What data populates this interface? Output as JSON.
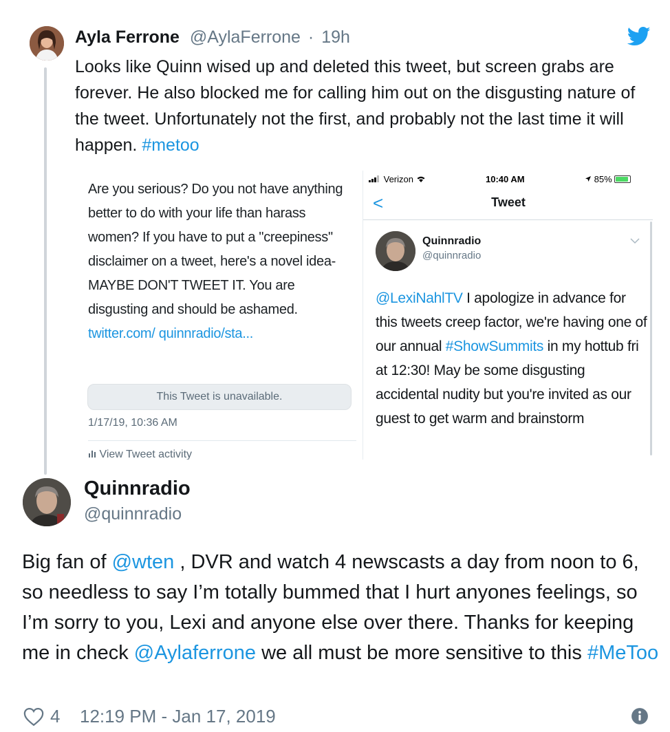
{
  "tweet1": {
    "name": "Ayla Ferrone",
    "handle": "@AylaFerrone",
    "separator": "·",
    "time": "19h",
    "text_before": "Looks like Quinn wised up and deleted this tweet, but screen grabs are forever. He also blocked me for calling him out on the disgusting nature of the tweet. Unfortunately not the first, and probably not the last time it will happen. ",
    "hashtag": "#metoo",
    "icons": {
      "avatar": "avatar",
      "brand": "twitter-bird-icon"
    }
  },
  "screengrab_left": {
    "text": "Are you serious? Do you not have anything better to do with your life than harass women? If you have to put a \"creepiness\" disclaimer on a tweet, here's a novel idea-MAYBE DON'T TWEET IT. You are disgusting and should be ashamed. ",
    "link": "twitter.com/ quinnradio/sta...",
    "unavailable": "This Tweet is unavailable.",
    "date": "1/17/19, 10:36 AM",
    "activity": "View Tweet activity"
  },
  "screengrab_right": {
    "carrier": "Verizon",
    "time": "10:40 AM",
    "battery": "85%",
    "back_glyph": "<",
    "title": "Tweet",
    "author_name": "Quinnradio",
    "author_handle": "@quinnradio",
    "mention": "@LexiNahlTV",
    "text_part1": " I apologize in advance for this tweets creep factor, we're having one of our annual ",
    "hashtag": "#ShowSummits",
    "text_part2": " in my hottub fri at 12:30! May be some disgusting accidental nudity but you're invited as our guest to get warm and brainstorm"
  },
  "tweet2": {
    "name": "Quinnradio",
    "handle": "@quinnradio",
    "text_1": "Big fan of ",
    "mention_1": "@wten",
    "text_2": " , DVR and watch 4 newscasts a day from noon to 6, so needless to say I’m totally bummed that I hurt anyones feelings, so I’m sorry to you, Lexi and anyone else over there. Thanks for keeping me in check ",
    "mention_2": "@Aylaferrone",
    "text_3": " we all must be more sensitive to this ",
    "hashtag": "#MeToo",
    "likes": "4",
    "timestamp": "12:19 PM - Jan 17, 2019",
    "icons": {
      "like": "heart-icon",
      "info": "info-icon"
    }
  },
  "colors": {
    "link": "#1b95e0",
    "secondary_text": "#657786",
    "text": "#14171a",
    "twitter_blue": "#1da1f2"
  }
}
